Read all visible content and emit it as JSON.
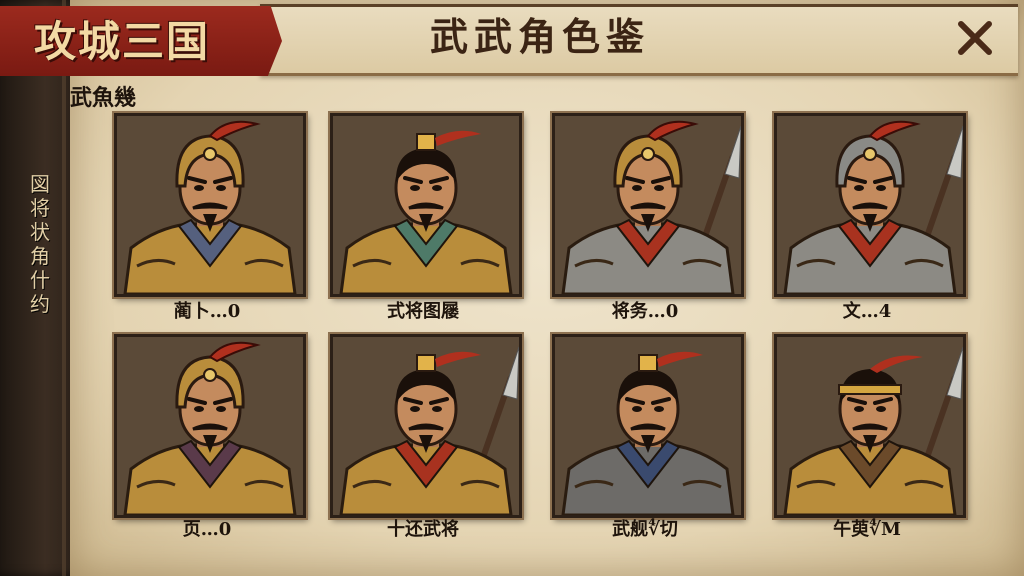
{
  "logo": {
    "text": "攻城三国"
  },
  "header": {
    "title": "武武角色鉴",
    "close_label": "✕"
  },
  "section": {
    "label": "武魚幾"
  },
  "side_menu": {
    "chars": [
      "図",
      "将",
      "状",
      "角",
      "什",
      "约"
    ]
  },
  "characters": [
    {
      "name": "蔺卜…0",
      "headgear": "helmet",
      "plume": "#b0301e",
      "scarf": "#55607e",
      "armor": "#b98d3b",
      "weapon": "none"
    },
    {
      "name": "式将图屦",
      "headgear": "topknot",
      "plume": "#b0301e",
      "scarf": "#4e7a68",
      "armor": "#b98d3b",
      "weapon": "none"
    },
    {
      "name": "将务…0",
      "headgear": "helmet",
      "plume": "#b0301e",
      "scarf": "#a8321f",
      "armor": "#8c8a84",
      "weapon": "spear"
    },
    {
      "name": "文…4",
      "headgear": "helmet-silver",
      "plume": "#b0301e",
      "scarf": "#a8321f",
      "armor": "#8c8a84",
      "weapon": "spear"
    },
    {
      "name": "页…0",
      "headgear": "helmet",
      "plume": "#b0301e",
      "scarf": "#5a3a4a",
      "armor": "#b98d3b",
      "weapon": "none"
    },
    {
      "name": "十还武将",
      "headgear": "topknot",
      "plume": "#b0301e",
      "scarf": "#a8321f",
      "armor": "#b98d3b",
      "weapon": "spear"
    },
    {
      "name": "武舰∜切",
      "headgear": "topknot",
      "plume": "#b0301e",
      "scarf": "#3a4a6e",
      "armor": "#6d6b68",
      "weapon": "none"
    },
    {
      "name": "午萸∜M",
      "headgear": "headband",
      "plume": "#b0301e",
      "scarf": "#6b4a2a",
      "armor": "#b98d3b",
      "weapon": "spear"
    }
  ],
  "colors": {
    "accent": "#9c2a1e",
    "parchment": "#e9dcbf",
    "ink": "#1e140c"
  }
}
